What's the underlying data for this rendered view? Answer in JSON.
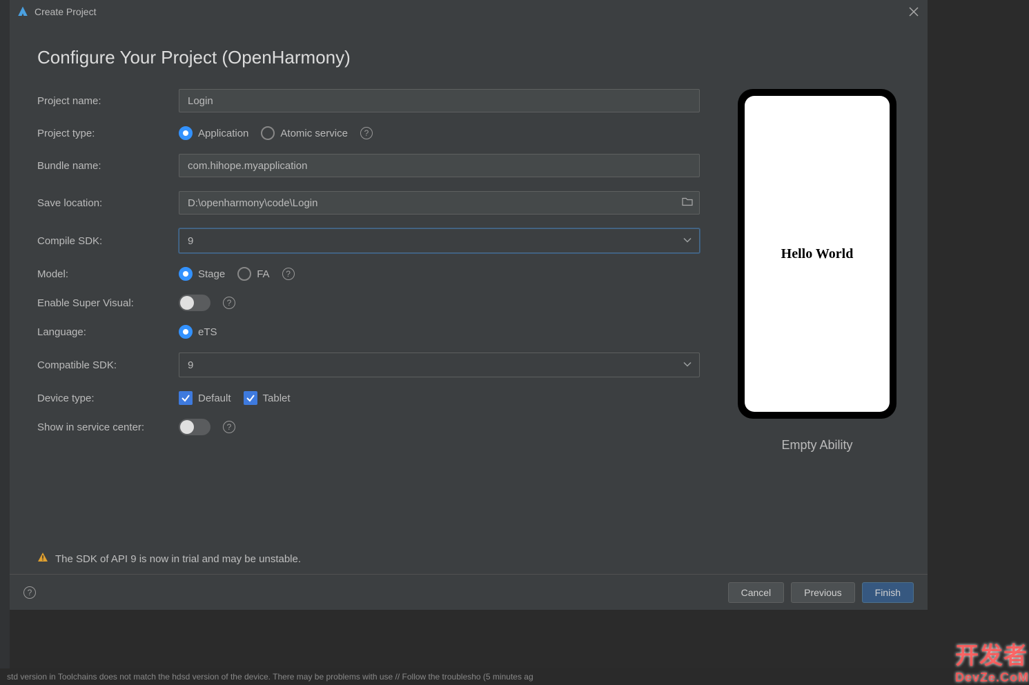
{
  "titlebar": {
    "title": "Create Project"
  },
  "heading": "Configure Your Project (OpenHarmony)",
  "form": {
    "project_name": {
      "label": "Project name:",
      "value": "Login"
    },
    "project_type": {
      "label": "Project type:",
      "option_app": "Application",
      "option_atomic": "Atomic service"
    },
    "bundle_name": {
      "label": "Bundle name:",
      "value": "com.hihope.myapplication"
    },
    "save_location": {
      "label": "Save location:",
      "value": "D:\\openharmony\\code\\Login"
    },
    "compile_sdk": {
      "label": "Compile SDK:",
      "value": "9"
    },
    "model": {
      "label": "Model:",
      "option_stage": "Stage",
      "option_fa": "FA"
    },
    "enable_super_visual": {
      "label": "Enable Super Visual:"
    },
    "language": {
      "label": "Language:",
      "option_ets": "eTS"
    },
    "compatible_sdk": {
      "label": "Compatible SDK:",
      "value": "9"
    },
    "device_type": {
      "label": "Device type:",
      "option_default": "Default",
      "option_tablet": "Tablet"
    },
    "show_in_service_center": {
      "label": "Show in service center:"
    }
  },
  "preview": {
    "screen_text": "Hello World",
    "label": "Empty Ability"
  },
  "warning": "The SDK of API 9 is now in trial and may be unstable.",
  "footer": {
    "cancel": "Cancel",
    "previous": "Previous",
    "finish": "Finish"
  },
  "statusbar": "std version in Toolchains does not match the hdsd version of the device. There may be problems with use // Follow the troublesho   (5 minutes ag",
  "watermark": {
    "main": "开发者",
    "sub": "DevZe.CoM"
  }
}
